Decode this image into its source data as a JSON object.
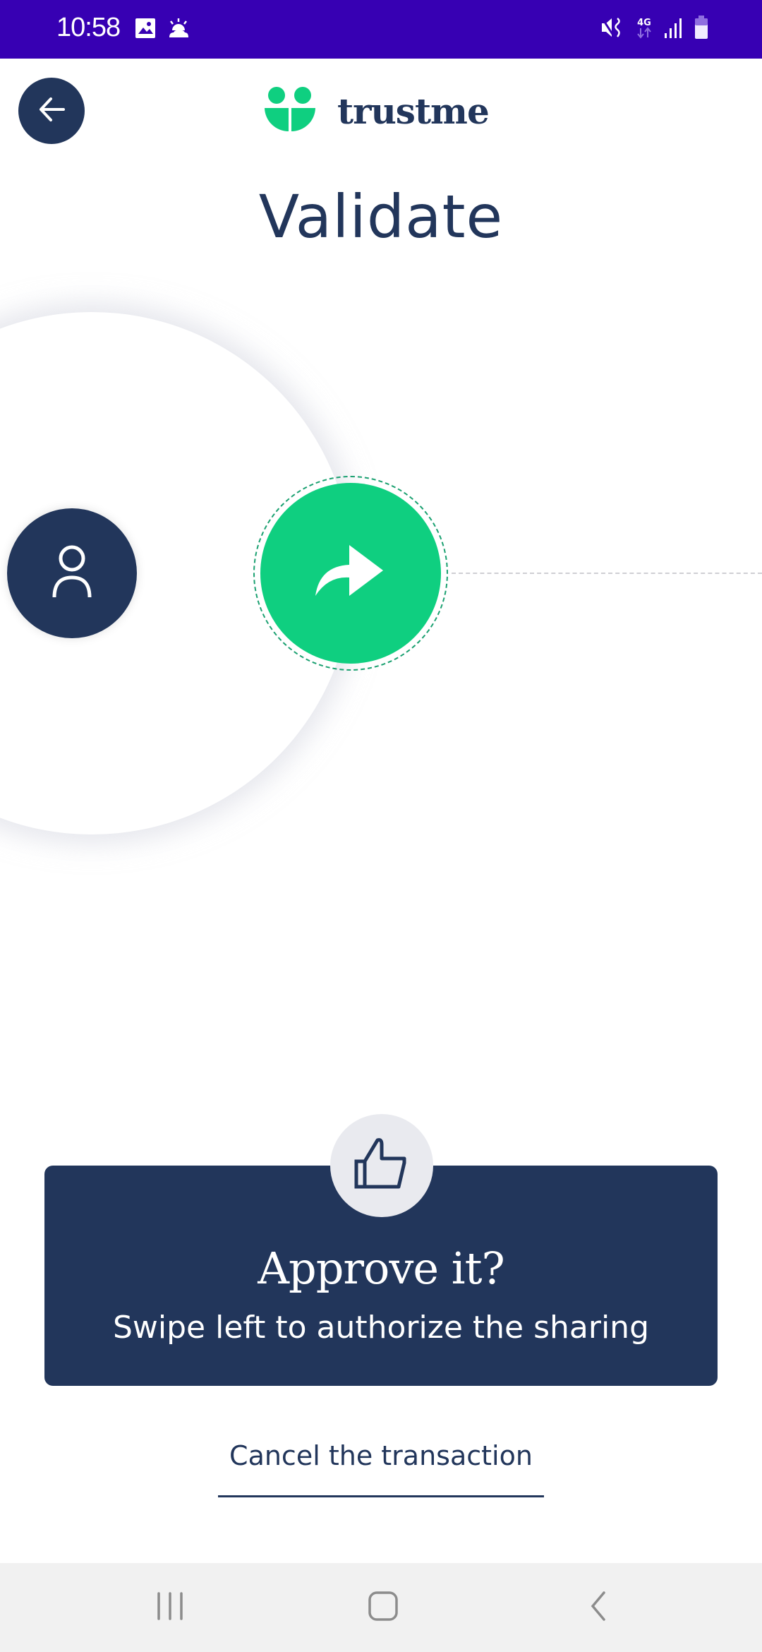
{
  "status_bar": {
    "time": "10:58",
    "left_icons": [
      "gallery-icon",
      "weather-icon"
    ],
    "right_icons": [
      "mute-vibrate-icon",
      "network-4g-icon",
      "signal-icon",
      "battery-icon"
    ],
    "network_label": "4G",
    "background_color": "#3700b3"
  },
  "header": {
    "back_icon": "arrow-left-icon",
    "logo_text": "trustme",
    "logo_color": "#0fcf80",
    "title": "Validate"
  },
  "swipe": {
    "user_icon": "person-icon",
    "action_icon": "share-arrow-icon",
    "action_color": "#0fcf80",
    "user_color": "#22365b"
  },
  "approve_card": {
    "icon": "thumbs-up-icon",
    "title": "Approve it?",
    "subtitle": "Swipe left to authorize the sharing",
    "background_color": "#22365b"
  },
  "cancel": {
    "label": "Cancel the transaction"
  },
  "nav_bar": {
    "buttons": [
      "recent-apps-icon",
      "home-icon",
      "back-icon"
    ]
  }
}
